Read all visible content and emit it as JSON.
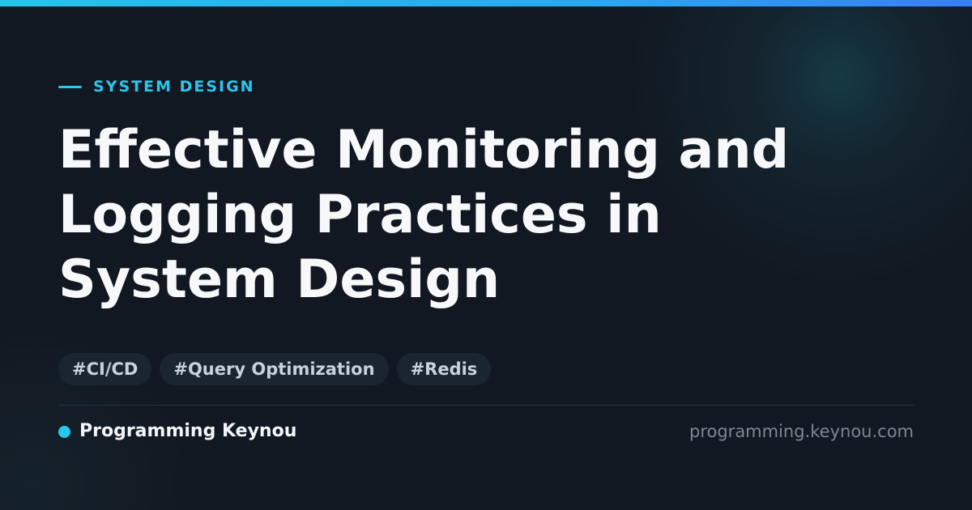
{
  "category": "SYSTEM DESIGN",
  "title_lines": [
    "Effective Monitoring and",
    "Logging Practices in",
    "System Design"
  ],
  "tags": [
    "#CI/CD",
    "#Query Optimization",
    "#Redis"
  ],
  "brand": {
    "name": "Programming Keynou",
    "url": "programming.keynou.com"
  },
  "colors": {
    "accent": "#2ac6ec",
    "background": "#121821",
    "tag_background": "#1b2530",
    "title_text": "#f7f8fa"
  },
  "icons": {
    "category_marker": "dash-line",
    "brand_marker": "dot-icon"
  }
}
